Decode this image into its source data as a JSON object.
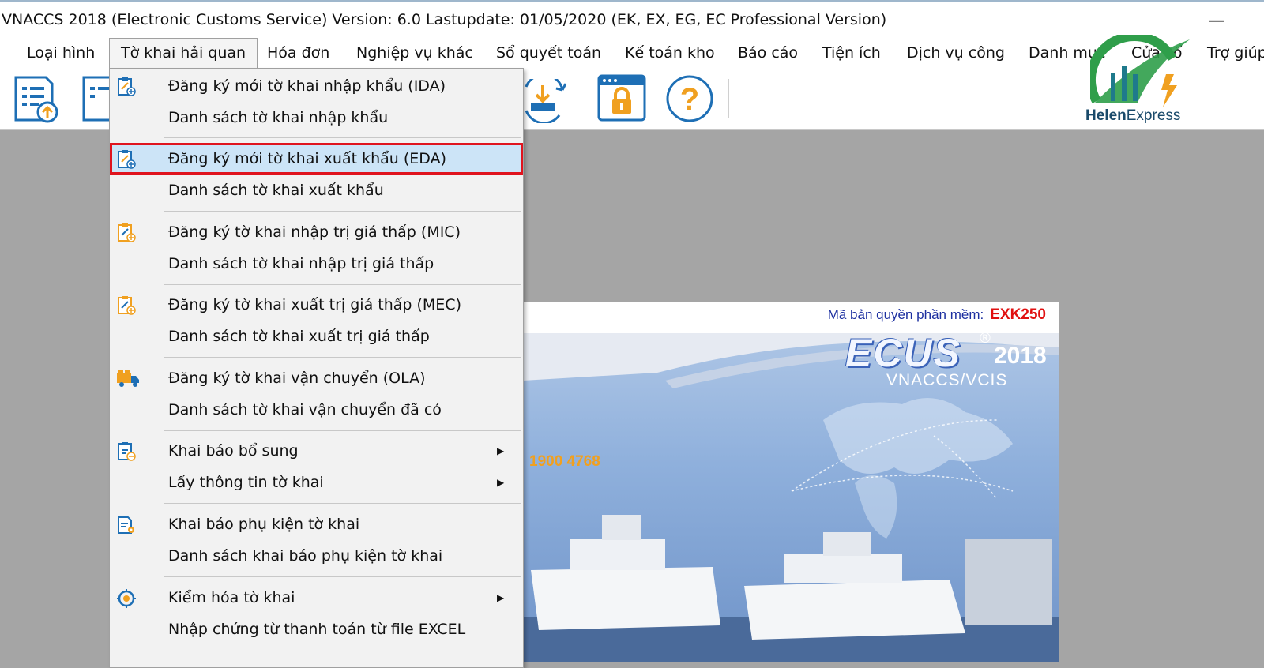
{
  "window": {
    "title": "VNACCS 2018 (Electronic Customs Service) Version: 6.0 Lastupdate: 01/05/2020 (EK, EX, EG, EC Professional Version)",
    "minimize_glyph": "—"
  },
  "menubar": {
    "items": [
      {
        "label": "Loại hình"
      },
      {
        "label": "Tờ khai hải quan"
      },
      {
        "label": "Hóa đơn"
      },
      {
        "label": "Nghiệp vụ khác"
      },
      {
        "label": "Sổ quyết toán"
      },
      {
        "label": "Kế toán kho"
      },
      {
        "label": "Báo cáo"
      },
      {
        "label": "Tiện ích"
      },
      {
        "label": "Dịch vụ công"
      },
      {
        "label": "Danh mục"
      },
      {
        "label": "Cửa sổ"
      },
      {
        "label": "Trợ giúp"
      }
    ],
    "active_index": 1
  },
  "toolbar": {
    "icons": [
      "import-declaration-icon",
      "export-declaration-icon",
      "download-icon",
      "lock-window-icon",
      "help-icon"
    ],
    "help_glyph": "?"
  },
  "logo": {
    "brand": "Helen",
    "brand_suffix": "Express"
  },
  "dropdown": {
    "items": [
      {
        "label": "Đăng ký mới tờ khai nhập khẩu (IDA)",
        "icon": "register-declaration-icon"
      },
      {
        "label": "Danh sách tờ khai nhập khẩu"
      },
      {
        "label": "Đăng ký mới tờ khai xuất khẩu (EDA)",
        "icon": "register-declaration-icon",
        "selected": true
      },
      {
        "label": "Danh sách tờ khai xuất khẩu"
      },
      {
        "label": "Đăng ký tờ khai nhập trị giá thấp (MIC)",
        "icon": "register-declaration-icon"
      },
      {
        "label": "Danh sách tờ khai nhập trị giá thấp"
      },
      {
        "label": "Đăng ký tờ khai xuất trị giá thấp (MEC)",
        "icon": "register-declaration-icon"
      },
      {
        "label": "Danh sách tờ khai xuất trị giá thấp"
      },
      {
        "label": "Đăng ký tờ khai vận chuyển (OLA)",
        "icon": "truck-icon"
      },
      {
        "label": "Danh sách tờ khai vận chuyển đã có"
      },
      {
        "label": "Khai báo bổ sung",
        "icon": "supplement-declaration-icon",
        "submenu": true
      },
      {
        "label": "Lấy thông tin tờ khai",
        "submenu": true
      },
      {
        "label": "Khai báo phụ kiện tờ khai",
        "icon": "attachment-declaration-icon"
      },
      {
        "label": "Danh sách khai báo phụ kiện tờ khai"
      },
      {
        "label": "Kiểm hóa tờ khai",
        "icon": "inspection-icon",
        "submenu": true
      },
      {
        "label": "Nhập chứng từ thanh toán từ file EXCEL"
      }
    ],
    "submenu_glyph": "▶"
  },
  "splash": {
    "license_label": "Mã bản quyền phần mềm:",
    "license_code": "EXK250",
    "product": "ECUS",
    "registered": "®",
    "year": "2018",
    "subtitle": "VNACCS/VCIS",
    "hotline": "1900 4768"
  },
  "colors": {
    "menu_highlight": "#cce4f7",
    "selection_outline": "#e0141e",
    "icon_blue": "#1e6fb5",
    "icon_orange": "#f0a020"
  }
}
